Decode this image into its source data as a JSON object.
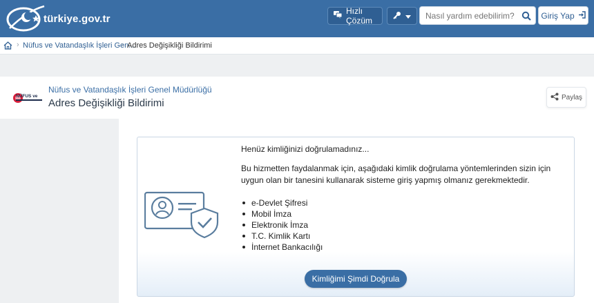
{
  "topbar": {
    "logo_text": "türkiye.gov.tr",
    "quick_solution_label": "Hızlı Çözüm",
    "search_placeholder": "Nasıl yardım edebilirim?",
    "login_label": "Giriş Yap",
    "bg_color": "#3a6ea5"
  },
  "breadcrumb": {
    "items": [
      "Nüfus ve Vatandaşlık İşleri Gen...",
      "Adres Değişikliği Bildirimi"
    ]
  },
  "header": {
    "institution_name": "Nüfus ve Vatandaşlık İşleri Genel Müdürlüğü",
    "service_name": "Adres Değişikliği Bildirimi",
    "share_label": "Paylaş",
    "logo_text": "NÜFUS ve"
  },
  "notice": {
    "title": "Henüz kimliğinizi doğrulamadınız...",
    "description": "Bu hizmetten faydalanmak için, aşağıdaki kimlik doğrulama yöntemlerinden sizin için uygun olan bir tanesini kullanarak sisteme giriş yapmış olmanız gerekmektedir.",
    "methods": [
      "e-Devlet Şifresi",
      "Mobil İmza",
      "Elektronik İmza",
      "T.C. Kimlik Kartı",
      "İnternet Bankacılığı"
    ],
    "verify_button_label": "Kimliğimi Şimdi Doğrula"
  }
}
